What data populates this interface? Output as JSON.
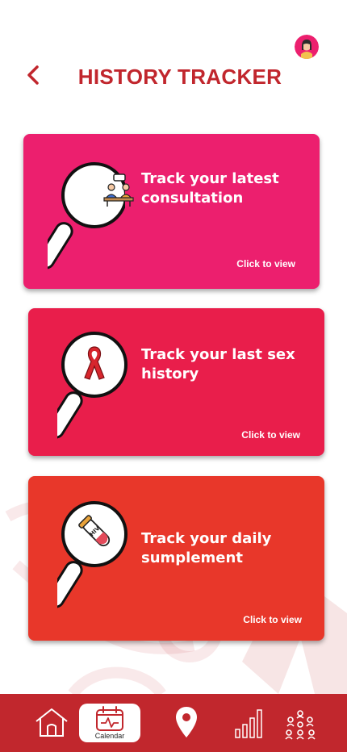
{
  "header": {
    "title": "HISTORY TRACKER"
  },
  "cards": [
    {
      "label": "Track your latest consultation",
      "cta": "Click to view",
      "icon": "consultation-icon",
      "color": "#ec1f6e"
    },
    {
      "label": "Track your last sex history",
      "cta": "Click to view",
      "icon": "red-ribbon-icon",
      "color": "#e91e4b"
    },
    {
      "label": "Track your daily sumplement",
      "cta": "Click to view",
      "icon": "hiv-test-tube-icon",
      "color": "#e8372a"
    }
  ],
  "nav": {
    "calendar_label": "Calendar",
    "items": [
      "home-icon",
      "calendar-icon",
      "location-pin-icon",
      "stats-bars-icon",
      "community-icon"
    ],
    "bar_color": "#c1272d"
  },
  "colors": {
    "title": "#c1262d"
  }
}
